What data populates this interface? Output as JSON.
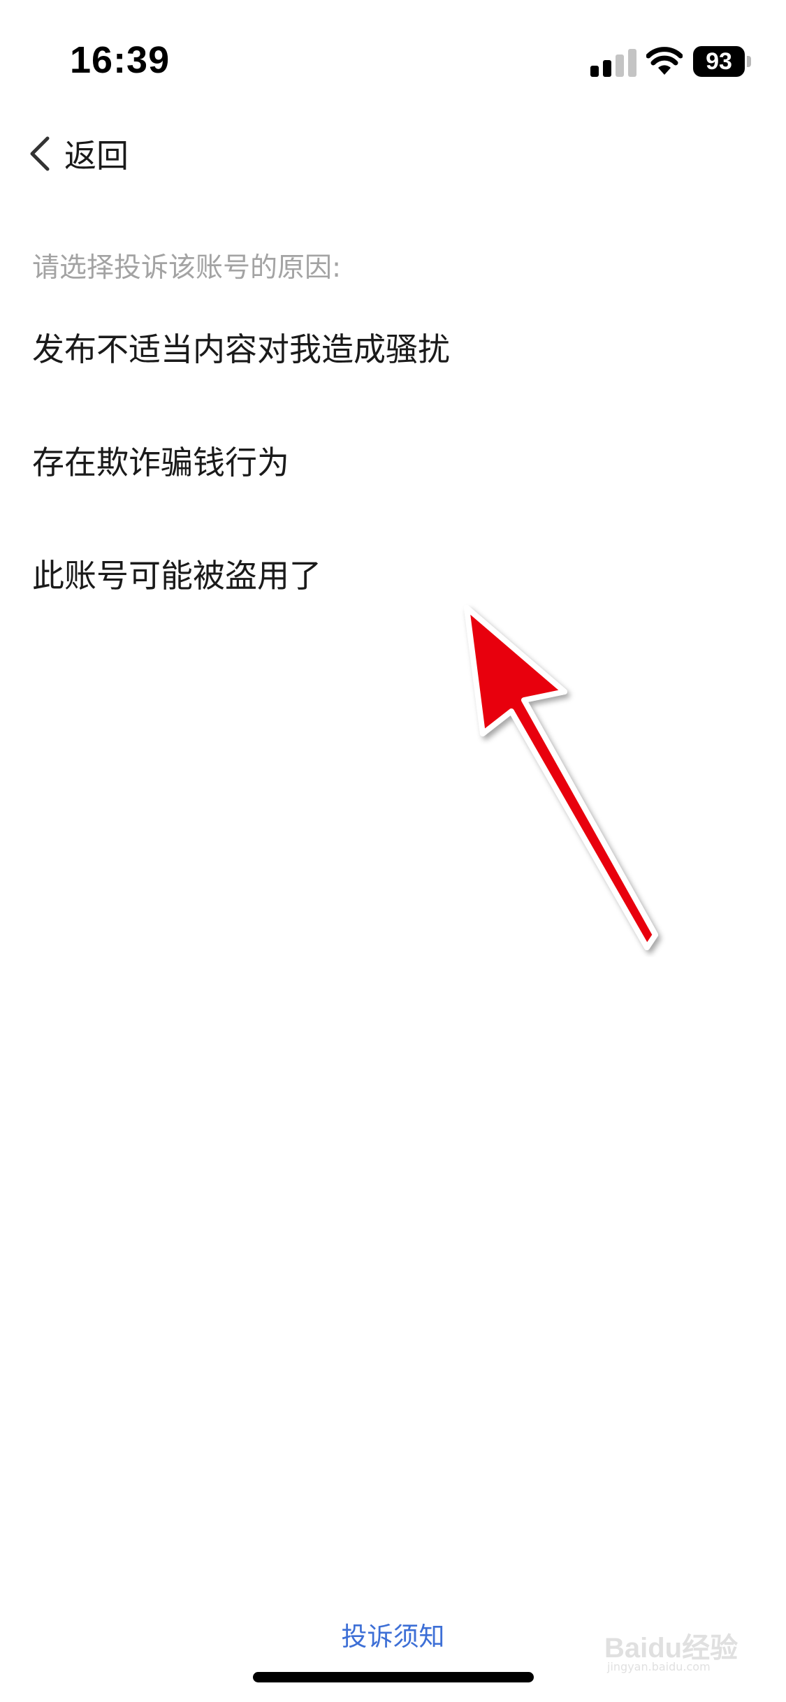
{
  "status_bar": {
    "time": "16:39",
    "battery": "93",
    "icons": [
      "signal-icon",
      "wifi-icon",
      "battery-icon"
    ]
  },
  "nav": {
    "back_label": "返回",
    "back_icon": "chevron-left-icon"
  },
  "prompt": "请选择投诉该账号的原因:",
  "reasons": [
    {
      "label": "发布不适当内容对我造成骚扰"
    },
    {
      "label": "存在欺诈骗钱行为"
    },
    {
      "label": "此账号可能被盗用了"
    }
  ],
  "annotation": {
    "icon": "arrow-pointer-icon",
    "color": "#e8000b"
  },
  "footer": {
    "notice_link": "投诉须知",
    "link_color": "#3d6fd6"
  },
  "watermark": {
    "text": "Baidu经验",
    "sub": "jingyan.baidu.com"
  }
}
